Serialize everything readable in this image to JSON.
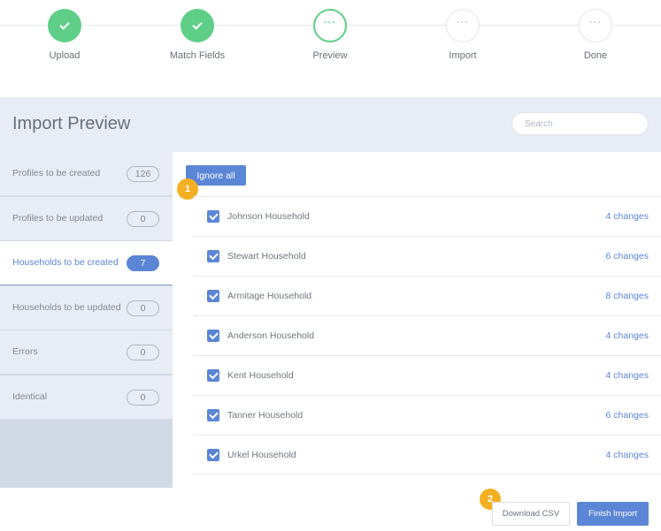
{
  "stepper": {
    "steps": [
      {
        "label": "Upload",
        "state": "done"
      },
      {
        "label": "Match Fields",
        "state": "done"
      },
      {
        "label": "Preview",
        "state": "current",
        "glyph": "···"
      },
      {
        "label": "Import",
        "state": "pending",
        "glyph": "···"
      },
      {
        "label": "Done",
        "state": "pending",
        "glyph": "···"
      }
    ]
  },
  "header": {
    "title": "Import Preview",
    "search_placeholder": "Search"
  },
  "sidebar": {
    "items": [
      {
        "label": "Profiles to be created",
        "count": "126"
      },
      {
        "label": "Profiles to be updated",
        "count": "0"
      },
      {
        "label": "Households to be created",
        "count": "7",
        "active": true
      },
      {
        "label": "Households to be updated",
        "count": "0"
      },
      {
        "label": "Errors",
        "count": "0"
      },
      {
        "label": "Identical",
        "count": "0"
      }
    ]
  },
  "main": {
    "ignore_all_label": "Ignore all",
    "rows": [
      {
        "name": "Johnson Household",
        "changes": "4 changes",
        "checked": true
      },
      {
        "name": "Stewart Household",
        "changes": "6 changes",
        "checked": true
      },
      {
        "name": "Armitage Household",
        "changes": "8 changes",
        "checked": true
      },
      {
        "name": "Anderson Household",
        "changes": "4 changes",
        "checked": true
      },
      {
        "name": "Kent Household",
        "changes": "4 changes",
        "checked": true
      },
      {
        "name": "Tanner Household",
        "changes": "6 changes",
        "checked": true
      },
      {
        "name": "Urkel Household",
        "changes": "4 changes",
        "checked": true
      }
    ]
  },
  "callouts": [
    "1",
    "2"
  ],
  "footer": {
    "download_label": "Download CSV",
    "finish_label": "Finish Import"
  },
  "colors": {
    "accent": "#5b86d6",
    "success": "#5fce87",
    "callout": "#f4b022"
  }
}
